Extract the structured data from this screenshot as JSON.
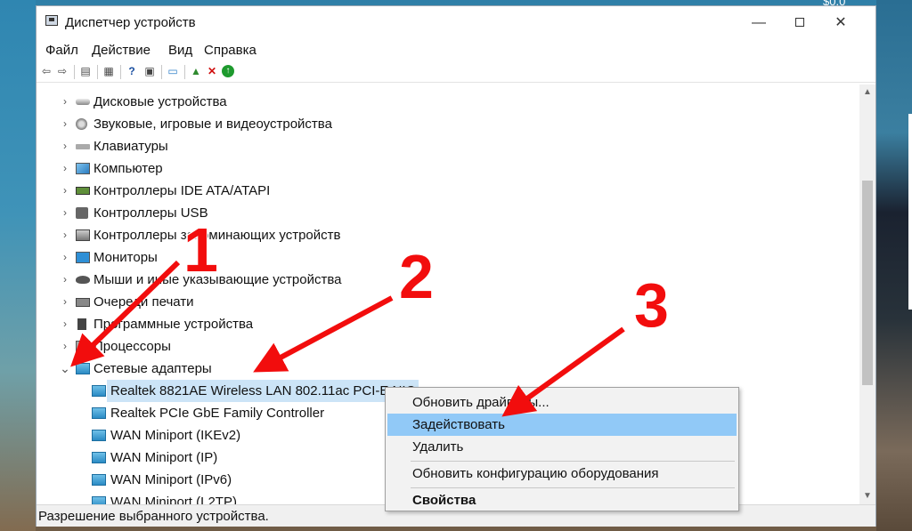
{
  "desktop": {
    "top_text": "$0.0"
  },
  "window": {
    "title": "Диспетчер устройств",
    "controls": {
      "minimize": "—",
      "maximize": "",
      "close": "✕"
    }
  },
  "menubar": {
    "items": [
      {
        "label": "Файл"
      },
      {
        "label": "Действие"
      },
      {
        "label": "Вид"
      },
      {
        "label": "Справка"
      }
    ]
  },
  "toolbar": {
    "icons": [
      "back-icon",
      "forward-icon",
      "properties-icon",
      "view-icon",
      "help-icon",
      "device-view-icon",
      "monitor-icon",
      "update-driver-icon",
      "uninstall-icon",
      "enable-icon"
    ]
  },
  "tree": {
    "categories": [
      {
        "label": "Дисковые устройства"
      },
      {
        "label": "Звуковые, игровые и видеоустройства"
      },
      {
        "label": "Клавиатуры"
      },
      {
        "label": "Компьютер"
      },
      {
        "label": "Контроллеры IDE ATA/ATAPI"
      },
      {
        "label": "Контроллеры USB"
      },
      {
        "label": "Контроллеры запоминающих устройств"
      },
      {
        "label": "Мониторы"
      },
      {
        "label": "Мыши и иные указывающие устройства"
      },
      {
        "label": "Очереди печати"
      },
      {
        "label": "Программные устройства"
      },
      {
        "label": "Процессоры"
      },
      {
        "label": "Сетевые адаптеры"
      }
    ],
    "network_children": [
      {
        "label": "Realtek 8821AE Wireless LAN 802.11ac PCI-E NIC"
      },
      {
        "label": "Realtek PCIe GbE Family Controller"
      },
      {
        "label": "WAN Miniport (IKEv2)"
      },
      {
        "label": "WAN Miniport (IP)"
      },
      {
        "label": "WAN Miniport (IPv6)"
      },
      {
        "label": "WAN Miniport (L2TP)"
      }
    ],
    "chevron_collapsed": "›",
    "chevron_expanded": "⌄"
  },
  "context_menu": {
    "items": [
      {
        "label": "Обновить драйверы..."
      },
      {
        "label": "Задействовать"
      },
      {
        "label": "Удалить"
      },
      {
        "label": "Обновить конфигурацию оборудования"
      },
      {
        "label": "Свойства"
      }
    ]
  },
  "statusbar": {
    "text": "Разрешение выбранного устройства."
  },
  "annotations": {
    "n1": "1",
    "n2": "2",
    "n3": "3",
    "color": "#f20d0d"
  }
}
